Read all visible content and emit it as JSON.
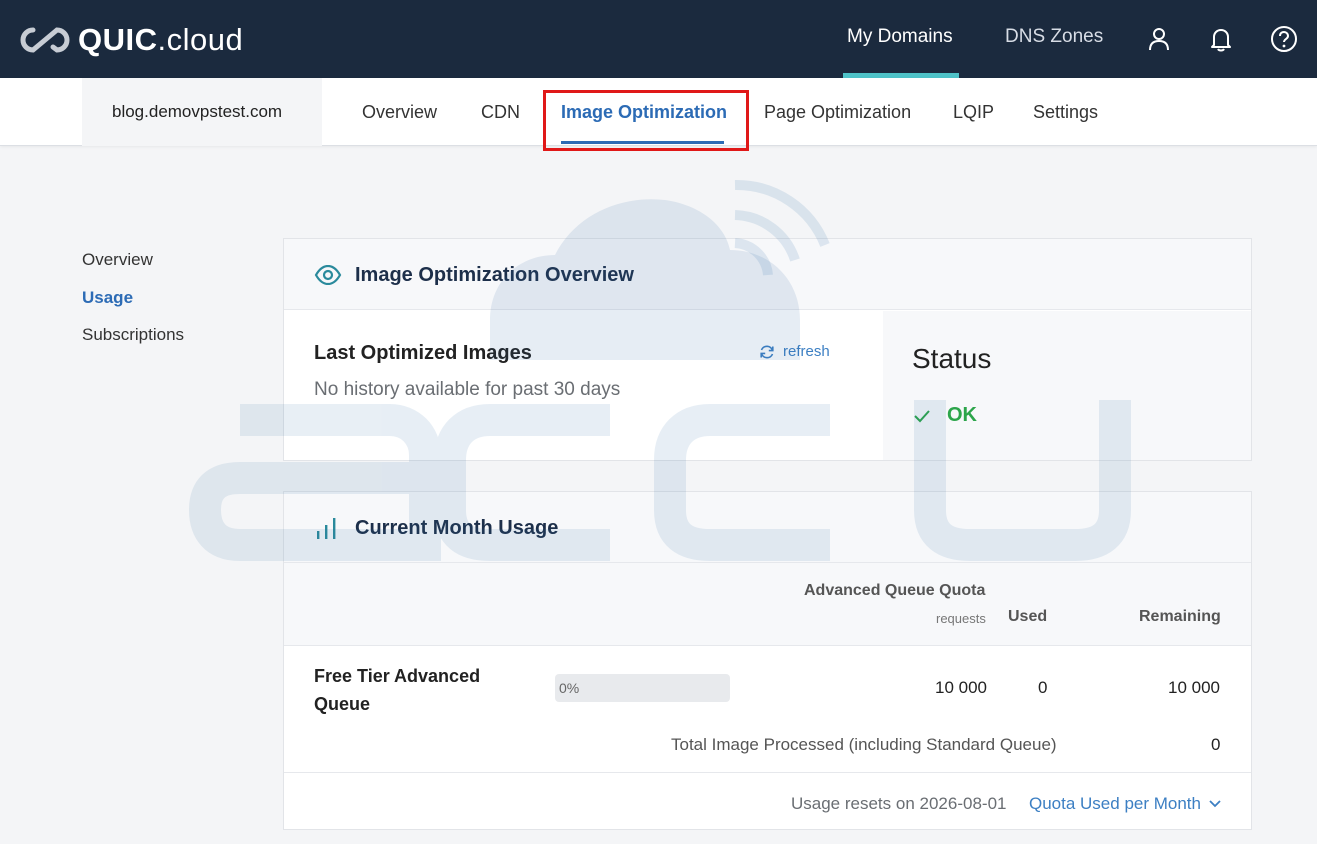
{
  "brand": {
    "name_bold": "QUIC",
    "name_rest": ".cloud"
  },
  "topnav": {
    "items": [
      {
        "label": "My Domains",
        "active": true
      },
      {
        "label": "DNS Zones",
        "active": false
      }
    ],
    "icons": [
      "user-icon",
      "bell-icon",
      "help-icon"
    ]
  },
  "domain": "blog.demovpstest.com",
  "subnav": {
    "tabs": [
      {
        "label": "Overview"
      },
      {
        "label": "CDN"
      },
      {
        "label": "Image Optimization",
        "active": true
      },
      {
        "label": "Page Optimization"
      },
      {
        "label": "LQIP"
      },
      {
        "label": "Settings"
      }
    ]
  },
  "sidemenu": {
    "items": [
      {
        "label": "Overview"
      },
      {
        "label": "Usage",
        "active": true
      },
      {
        "label": "Subscriptions"
      }
    ]
  },
  "overview_card": {
    "title": "Image Optimization Overview",
    "last_title": "Last Optimized Images",
    "last_empty": "No history available for past 30 days",
    "refresh_label": "refresh",
    "status_title": "Status",
    "status_value": "OK",
    "status_color": "#2ca54a"
  },
  "usage_card": {
    "title": "Current Month Usage",
    "header": {
      "quota": "Advanced Queue Quota",
      "quota_unit": "requests",
      "used": "Used",
      "remaining": "Remaining"
    },
    "row": {
      "label": "Free Tier Advanced Queue",
      "progress_percent": 0,
      "progress_label": "0%",
      "quota": "10 000",
      "used": "0",
      "remaining": "10 000"
    },
    "total_label": "Total Image Processed (including Standard Queue)",
    "total_value": "0",
    "reset_text": "Usage resets on 2026-08-01",
    "quota_link": "Quota Used per Month"
  },
  "colors": {
    "topbar": "#1b2a3e",
    "accent": "#4fc3c8",
    "link": "#2c6bb5",
    "highlight": "#e01818"
  }
}
